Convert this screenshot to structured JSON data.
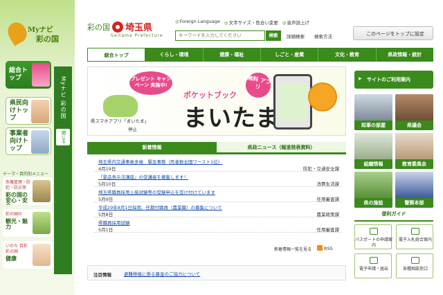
{
  "sidebar": {
    "brand_top": "Myナビ",
    "brand_bottom": "彩の国",
    "items": [
      {
        "label": "総合トップ"
      },
      {
        "label": "県民向けトップ"
      },
      {
        "label": "事業者向けトップ"
      }
    ],
    "vertical_label": "Myナビ 彩の国",
    "close_label": "閉じる",
    "theme_title": "テーマ・目的別メニュー",
    "themes": [
      {
        "small": "危機管理・防犯・防災等",
        "big": "彩の国の安心・安全"
      },
      {
        "small": "彩の国の",
        "big": "観光・魅力"
      },
      {
        "small": "いのち 百彩 彩の国",
        "big": "健康"
      }
    ]
  },
  "header": {
    "logo_left": "彩の国",
    "logo_right": "埼玉県",
    "logo_sub": "Saitama Prefecture",
    "links": [
      "Foreign Language",
      "文字サイズ・色合い変更",
      "音声読上げ"
    ],
    "search_placeholder": "キーワードを入力してください",
    "search_button": "検索",
    "advanced_search": "詳細検索",
    "search_method": "検索方法",
    "set_top": "このページをトップに設定"
  },
  "global_nav": [
    "総合トップ",
    "くらし・環境",
    "健康・福祉",
    "しごと・産業",
    "文化・教育",
    "県政情報・統計"
  ],
  "banner": {
    "campaign": "プレゼント キャンペーン 実施中!",
    "free_app": "無料 アプリ",
    "subtitle": "ポケットブック",
    "title": "まいたま",
    "caption": "県スマホアプリ「まいたま」",
    "stop": "停止"
  },
  "news_tabs": [
    "新着情報",
    "県政ニュース（報道発表資料）"
  ],
  "news": [
    {
      "title": "埼玉県内交通事故多発　緊急事態（死者数全国ワースト1位）",
      "date": "4月19日",
      "category": "防犯・交通安全課"
    },
    {
      "title": "「景品表示法講座」の受講者を募集します！",
      "date": "5月10日",
      "category": "消費生活課"
    },
    {
      "title": "埼玉県職員採用上級試験等の受験申込を受け付けています",
      "date": "5月9日",
      "category": "任用審査課"
    },
    {
      "title": "平成29年8月1日採用、任期付職員（農業職）の募集について",
      "date": "5月8日",
      "category": "農業政策課"
    },
    {
      "title": "県職員採用試験",
      "date": "5月1日",
      "category": "任用審査課"
    }
  ],
  "news_more": "新着情報一覧を見る",
  "rss": "RSS",
  "attention": {
    "label": "注目情報",
    "link": "避難移植に係る募金のご協力について"
  },
  "right": {
    "guide": "サイトのご利用案内",
    "tiles": [
      "知事の部屋",
      "県議会",
      "組織情報",
      "教育委員会",
      "県の施設",
      "警察本部"
    ],
    "benri_title": "便利ガイド",
    "benri": [
      "パスポートの申請案内",
      "電子入札総合案内",
      "電子申請・届出",
      "各種相談窓口"
    ]
  }
}
